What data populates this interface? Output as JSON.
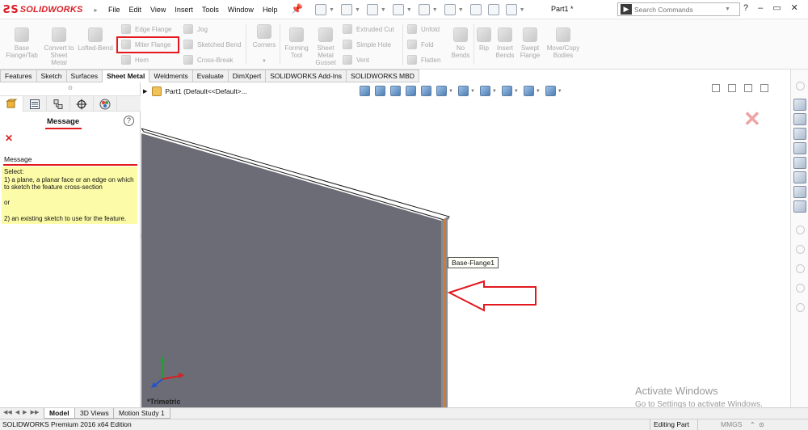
{
  "app": {
    "brand": "SOLIDWORKS",
    "menu": [
      "File",
      "Edit",
      "View",
      "Insert",
      "Tools",
      "Window",
      "Help"
    ],
    "document_title": "Part1 *",
    "search_placeholder": "Search Commands",
    "window_controls": [
      "?",
      "–",
      "▭",
      "✕"
    ]
  },
  "ribbon": {
    "large_buttons": [
      {
        "id": "base-flange",
        "label": "Base Flange/Tab"
      },
      {
        "id": "convert-sheet-metal",
        "label": "Convert to Sheet Metal"
      },
      {
        "id": "lofted-bend",
        "label": "Lofted-Bend"
      },
      {
        "id": "corners",
        "label": "Corners"
      },
      {
        "id": "forming-tool",
        "label": "Forming Tool"
      },
      {
        "id": "sheet-metal-gusset",
        "label": "Sheet Metal Gusset"
      },
      {
        "id": "no-bends",
        "label": "No Bends"
      },
      {
        "id": "rip",
        "label": "Rip"
      },
      {
        "id": "insert-bends",
        "label": "Insert Bends"
      },
      {
        "id": "swept-flange",
        "label": "Swept Flange"
      },
      {
        "id": "move-copy-bodies",
        "label": "Move/Copy Bodies"
      }
    ],
    "small_buttons": {
      "edge_flange": "Edge Flange",
      "miter_flange": "Miter Flange",
      "hem": "Hem",
      "jog": "Jog",
      "sketched_bend": "Sketched Bend",
      "cross_break": "Cross-Break",
      "extruded_cut": "Extruded Cut",
      "simple_hole": "Simple Hole",
      "vent": "Vent",
      "unfold": "Unfold",
      "fold": "Fold",
      "flatten": "Flatten"
    },
    "tabs": [
      "Features",
      "Sketch",
      "Surfaces",
      "Sheet Metal",
      "Weldments",
      "Evaluate",
      "DimXpert",
      "SOLIDWORKS Add-Ins",
      "SOLIDWORKS MBD"
    ],
    "active_tab": "Sheet Metal"
  },
  "property_manager": {
    "title": "Message",
    "section_title": "Message",
    "message_lines": [
      "Select:",
      "1) a plane, a planar face or an edge on which to sketch the feature cross-section",
      "or",
      "2) an existing sketch to use for the feature."
    ]
  },
  "graphics": {
    "tree_root": "Part1  (Default<<Default>...",
    "tooltip": "Base-Flange1",
    "view_label": "*Trimetric",
    "watermark_title": "Activate Windows",
    "watermark_sub": "Go to Settings to activate Windows."
  },
  "bottom_tabs": [
    "Model",
    "3D Views",
    "Motion Study 1"
  ],
  "active_bottom_tab": "Model",
  "status": {
    "left": "SOLIDWORKS Premium 2016 x64 Edition",
    "editing": "Editing Part",
    "units": "MMGS"
  },
  "colors": {
    "brand_red": "#da1f26",
    "highlight_red": "#e1191f",
    "part_face": "#6c6c76",
    "message_bg": "#fcfca8"
  }
}
